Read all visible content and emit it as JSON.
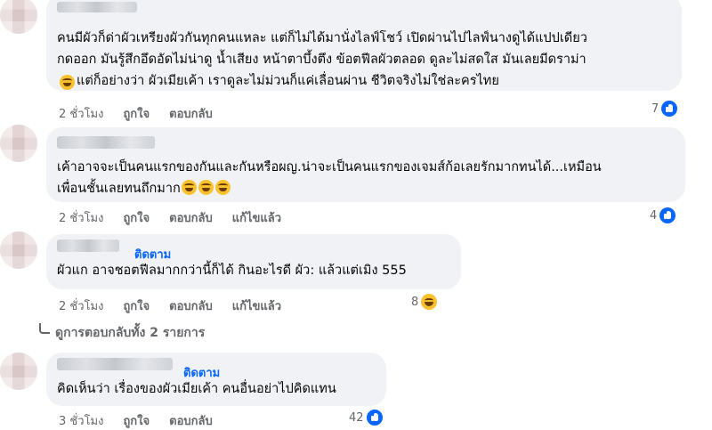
{
  "comments": [
    {
      "lines": [
        "คนมีผัวก็ด่าผัวเหรียงผัวกันทุกคนแหละ แต่ก็ไม่ได้มานั่งไลฟ์โชว์ เปิดผ่านไปไลฟ์นางดูได้แปปเดียว",
        "กดออก มันรู้สึกอึดอัดไม่น่าดู น้ำเสียง หน้าตาบึ้งตึง ข้อตฟีลผัวตลอด ดูละไม่สดใส มันเลยมีดราม่า",
        "แต่ก็อย่างว่า ผัวเมียเค้า เราดูละไม่ม่วนก็แค่เลื่อนผ่าน ชีวิตจริงไม่ใช่ละครไทย"
      ],
      "time": "2 ชั่วโมง",
      "like": "ถูกใจ",
      "reply": "ตอบกลับ",
      "reaction_count": "7",
      "reaction_icon": "like-icon"
    },
    {
      "lines": [
        "เค้าอาจจะเป็นคนแรกของกันและกันหรือผญ.น่าจะเป็นคนแรกของเจมส์ก้อเลยรักมากทนได้...เหมือน",
        "เพื่อนชั้นเลยทนถึกมาก"
      ],
      "time": "2 ชั่วโมง",
      "like": "ถูกใจ",
      "reply": "ตอบกลับ",
      "edited": "แก้ไขแล้ว",
      "reaction_count": "4",
      "reaction_icon": "like-icon"
    },
    {
      "follow": "ติดตาม",
      "lines": [
        "ผัวแก อาจชอตฟีลมากกว่านี้ก็ได้ กินอะไรดี ผัว: แล้วแต่เมิง 555"
      ],
      "time": "2 ชั่วโมง",
      "like": "ถูกใจ",
      "reply": "ตอบกลับ",
      "edited": "แก้ไขแล้ว",
      "reaction_count": "8",
      "reaction_icon": "haha-icon"
    },
    {
      "follow": "ติดตาม",
      "lines": [
        "คิดเห็นว่า เรื่องของผัวเมียเค้า คนอื่นอย่าไปคิดแทน"
      ],
      "time": "3 ชั่วโมง",
      "like": "ถูกใจ",
      "reply": "ตอบกลับ",
      "reaction_count": "42",
      "reaction_icon": "like-icon"
    }
  ],
  "view_replies": "ดูการตอบกลับทั้ง 2 รายการ"
}
